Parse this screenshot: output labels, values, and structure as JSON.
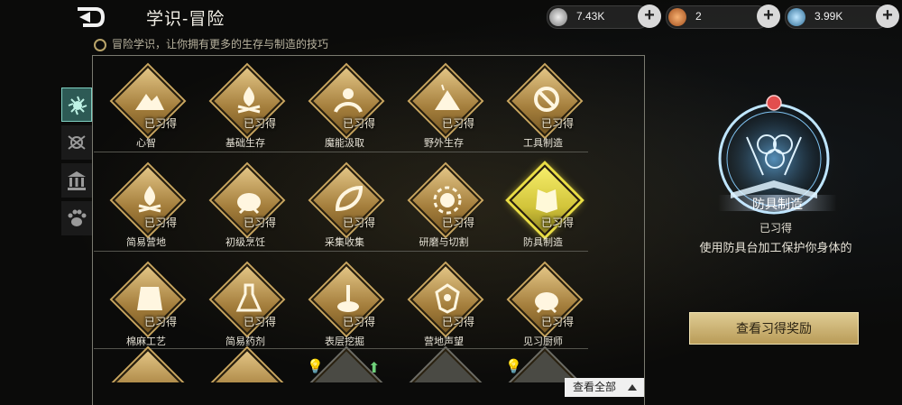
{
  "header": {
    "title": "学识-冒险"
  },
  "resources": [
    {
      "icon": "silver-gear-icon",
      "value": "7.43K",
      "color": "#c9c9c9"
    },
    {
      "icon": "orange-coin-icon",
      "value": "2",
      "color": "#d9824a"
    },
    {
      "icon": "blue-crystal-icon",
      "value": "3.99K",
      "color": "#6fa8c8"
    }
  ],
  "subtitle": "冒险学识，让你拥有更多的生存与制造的技巧",
  "tabs": [
    {
      "icon": "adventure-icon",
      "active": true
    },
    {
      "icon": "craft-icon",
      "active": false
    },
    {
      "icon": "building-icon",
      "active": false
    },
    {
      "icon": "paw-icon",
      "active": false
    }
  ],
  "learned_label": "已习得",
  "skills": [
    {
      "name": "心智",
      "glyph": "mountain-icon"
    },
    {
      "name": "基础生存",
      "glyph": "campfire-icon"
    },
    {
      "name": "魔能汲取",
      "glyph": "hand-orb-icon"
    },
    {
      "name": "野外生存",
      "glyph": "tent-icon"
    },
    {
      "name": "工具制造",
      "glyph": "tool-icon"
    },
    {
      "name": "简易营地",
      "glyph": "campfire-icon"
    },
    {
      "name": "初级烹饪",
      "glyph": "cauldron-icon"
    },
    {
      "name": "采集收集",
      "glyph": "leaf-hand-icon"
    },
    {
      "name": "研磨与切割",
      "glyph": "gear-icon"
    },
    {
      "name": "防具制造",
      "glyph": "armor-icon",
      "selected": true
    },
    {
      "name": "棉麻工艺",
      "glyph": "cloth-icon"
    },
    {
      "name": "简易药剂",
      "glyph": "flask-icon"
    },
    {
      "name": "表层挖掘",
      "glyph": "shovel-icon"
    },
    {
      "name": "营地声望",
      "glyph": "crest-icon"
    },
    {
      "name": "见习厨师",
      "glyph": "cauldron-icon"
    }
  ],
  "view_all": "查看全部",
  "detail": {
    "name": "防具制造",
    "status": "已习得",
    "description": "使用防具台加工保护你身体的"
  },
  "reward_button": "查看习得奖励"
}
